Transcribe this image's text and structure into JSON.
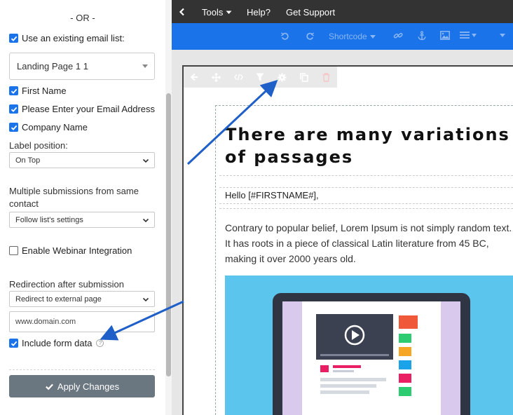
{
  "sidebar": {
    "or_label": "- OR -",
    "use_existing_list": {
      "label": "Use an existing email list:",
      "checked": true
    },
    "list_select": {
      "value": "Landing Page 1 1"
    },
    "fields": [
      {
        "label": "First Name",
        "checked": true
      },
      {
        "label": "Please Enter your Email Address",
        "checked": true
      },
      {
        "label": "Company Name",
        "checked": true
      }
    ],
    "label_position": {
      "label": "Label position:",
      "value": "On Top"
    },
    "multiple_submissions": {
      "label": "Multiple submissions from same contact",
      "value": "Follow list's settings"
    },
    "webinar": {
      "label": "Enable Webinar Integration",
      "checked": false
    },
    "redirection": {
      "label": "Redirection after submission",
      "value": "Redirect to external page"
    },
    "url_input": {
      "value": "www.domain.com"
    },
    "include_form_data": {
      "label": "Include form data",
      "checked": true,
      "help_icon": "question-icon"
    },
    "apply_button": {
      "label": "Apply Changes",
      "icon": "check-icon"
    }
  },
  "topbar": {
    "back_icon": "chevron-left-icon",
    "menu": [
      {
        "label": "Tools",
        "has_dropdown": true
      },
      {
        "label": "Help?",
        "has_dropdown": false
      },
      {
        "label": "Get Support",
        "has_dropdown": false
      }
    ]
  },
  "editor_toolbar": {
    "shortcode_label": "Shortcode",
    "icons": [
      "undo-icon",
      "redo-icon",
      "link-icon",
      "anchor-icon",
      "image-icon",
      "list-icon",
      "chevron-down-icon"
    ]
  },
  "block_tools": {
    "icons": [
      "arrow-left-icon",
      "move-icon",
      "code-icon",
      "filter-icon",
      "gear-icon",
      "copy-icon",
      "trash-icon"
    ]
  },
  "email": {
    "heading": "There are many variations of passages",
    "greeting": "Hello [#FIRSTNAME#],",
    "paragraph": "Contrary to popular belief, Lorem Ipsum is not simply random text. It has roots in a piece of classical Latin literature from 45 BC, making it over 2000 years old."
  },
  "colors": {
    "accent": "#1a73e8",
    "topbar": "#333333",
    "apply_button": "#6b7780",
    "annotation_arrow": "#1f5fc8",
    "hero_bg": "#5bc5ee"
  }
}
